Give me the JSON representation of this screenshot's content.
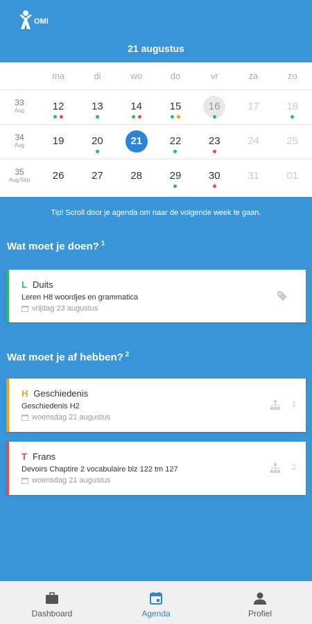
{
  "app": {
    "logo_text": "OMI"
  },
  "header": {
    "date_title": "21 augustus"
  },
  "calendar": {
    "day_names": [
      "ma",
      "di",
      "wo",
      "do",
      "vr",
      "za",
      "zo"
    ],
    "weeks": [
      {
        "week": "33",
        "month": "Aug",
        "days": [
          {
            "num": "12",
            "state": "normal",
            "dots": [
              "#2ebd59",
              "#e84c3d"
            ]
          },
          {
            "num": "13",
            "state": "normal",
            "dots": [
              "#2ebd59"
            ]
          },
          {
            "num": "14",
            "state": "normal",
            "dots": [
              "#2ebd59",
              "#e84c3d"
            ]
          },
          {
            "num": "15",
            "state": "normal",
            "dots": [
              "#2ebd59",
              "#f39c12"
            ]
          },
          {
            "num": "16",
            "state": "today",
            "dots": [
              "#2ebd59"
            ]
          },
          {
            "num": "17",
            "state": "muted",
            "dots": []
          },
          {
            "num": "18",
            "state": "muted",
            "dots": [
              "#2ebd59"
            ]
          }
        ]
      },
      {
        "week": "34",
        "month": "Aug",
        "days": [
          {
            "num": "19",
            "state": "normal",
            "dots": []
          },
          {
            "num": "20",
            "state": "normal",
            "dots": [
              "#2ebd59"
            ]
          },
          {
            "num": "21",
            "state": "selected",
            "dots": []
          },
          {
            "num": "22",
            "state": "normal",
            "dots": [
              "#2ebd59"
            ]
          },
          {
            "num": "23",
            "state": "normal",
            "dots": [
              "#e84c3d"
            ]
          },
          {
            "num": "24",
            "state": "muted",
            "dots": []
          },
          {
            "num": "25",
            "state": "muted",
            "dots": []
          }
        ]
      },
      {
        "week": "35",
        "month": "Aug/Sep",
        "days": [
          {
            "num": "26",
            "state": "normal",
            "dots": []
          },
          {
            "num": "27",
            "state": "normal",
            "dots": []
          },
          {
            "num": "28",
            "state": "normal",
            "dots": []
          },
          {
            "num": "29",
            "state": "normal",
            "dots": [
              "#2ebd59"
            ]
          },
          {
            "num": "30",
            "state": "normal",
            "dots": [
              "#e84c3d"
            ]
          },
          {
            "num": "31",
            "state": "muted",
            "dots": []
          },
          {
            "num": "01",
            "state": "muted",
            "dots": []
          }
        ]
      }
    ]
  },
  "tip": "Tip! Scroll door je agenda om naar de volgende week te gaan.",
  "section_todo": {
    "title": "Wat moet je doen?",
    "count": "1"
  },
  "section_done": {
    "title": "Wat moet je af hebben?",
    "count": "2"
  },
  "todo_cards": [
    {
      "letter": "L",
      "subject": "Duits",
      "description": "Leren H8 woordjes en grammatica",
      "date": "vrijdag 23 augustus",
      "color": "#2ebd59",
      "icon": "tag-icon"
    }
  ],
  "done_cards": [
    {
      "letter": "H",
      "subject": "Geschiedenis",
      "description": "Geschiedenis H2",
      "date": "woensdag 21 augustus",
      "color": "#f39c12",
      "icon": "tree-icon",
      "count": "1"
    },
    {
      "letter": "T",
      "subject": "Frans",
      "description": "Devoirs Chaptire 2 vocabulaire blz 122 tm 127",
      "date": "woensdag 21 augustus",
      "color": "#e84c3d",
      "icon": "tree-icon",
      "count": "2"
    }
  ],
  "nav": {
    "items": [
      {
        "label": "Dashboard",
        "icon": "briefcase-icon",
        "active": false
      },
      {
        "label": "Agenda",
        "icon": "calendar-icon",
        "active": true
      },
      {
        "label": "Profiel",
        "icon": "person-icon",
        "active": false
      }
    ]
  }
}
